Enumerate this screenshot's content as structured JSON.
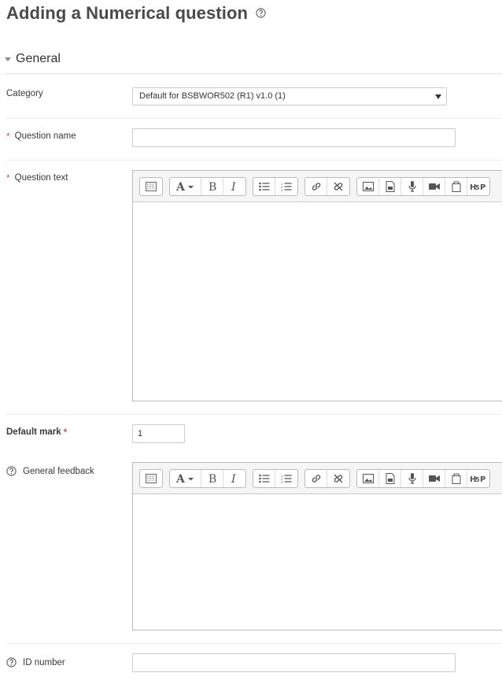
{
  "page": {
    "title": "Adding a Numerical question"
  },
  "section": {
    "general_label": "General"
  },
  "fields": {
    "category": {
      "label": "Category",
      "selected": "Default for BSBWOR502 (R1) v1.0 (1)"
    },
    "question_name": {
      "label": "Question name",
      "required_marker": "*",
      "value": ""
    },
    "question_text": {
      "label": "Question text",
      "required_marker": "*"
    },
    "default_mark": {
      "label": "Default mark",
      "required_marker": "*",
      "value": "1"
    },
    "general_feedback": {
      "label": "General feedback"
    },
    "id_number": {
      "label": "ID number",
      "value": ""
    }
  },
  "toolbar": {
    "buttons": [
      "show-more-buttons",
      "font-style",
      "bold",
      "italic",
      "unordered-list",
      "ordered-list",
      "link",
      "unlink",
      "image",
      "media-file",
      "record-audio",
      "record-video",
      "manage-files",
      "h5p"
    ]
  },
  "colors": {
    "required": "#d9534f",
    "title": "#4a4a4a",
    "toolbar_bg": "#f5f5f5"
  }
}
